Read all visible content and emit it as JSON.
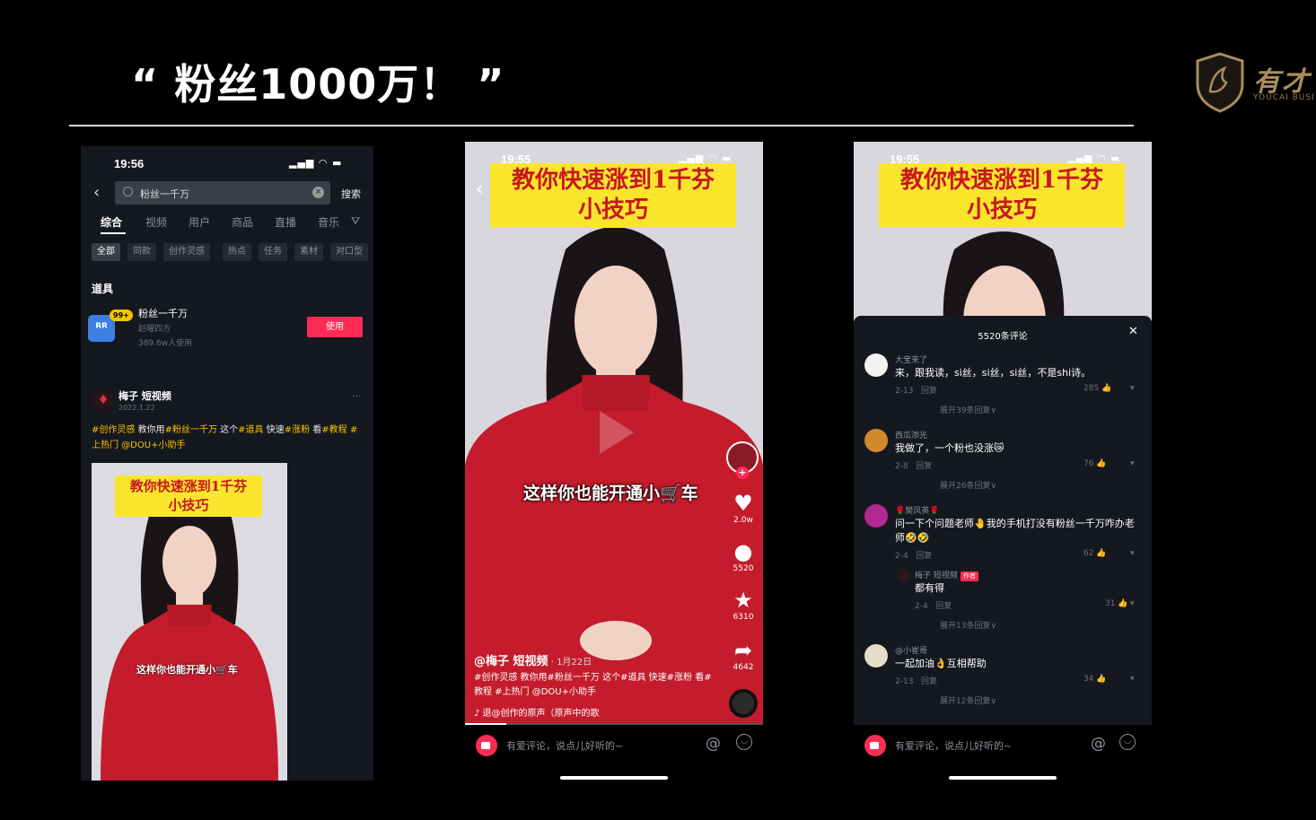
{
  "slide": {
    "title": "“ 粉丝1000万！ ”",
    "logo_text": "有才",
    "logo_sub": "YOUCAI BUSI"
  },
  "phone_search": {
    "status_time": "19:56",
    "search_query": "粉丝一千万",
    "search_button": "搜索",
    "tabs": [
      "综合",
      "视频",
      "用户",
      "商品",
      "直播",
      "音乐"
    ],
    "chips": [
      "全部",
      "同款",
      "创作灵感",
      "热点",
      "任务",
      "素材",
      "对口型"
    ],
    "section_label": "道具",
    "prop": {
      "badge": "99+",
      "name": "粉丝一千万",
      "author": "赵曜四方",
      "users": "389.6w人使用",
      "use_button": "使用"
    },
    "post": {
      "author": "梅子 短视频",
      "date": "2022.1.22",
      "caption_part1": "#创作灵感 ",
      "caption_part2": "教你用",
      "caption_part3": "#粉丝一千万",
      "caption_part4": " 这个",
      "caption_part5": "#道具",
      "caption_part6": " 快速",
      "caption_part7": "#涨粉",
      "caption_part8": " 看",
      "caption_part9": "#教程 #上热门",
      "caption_part10": " @DOU+小助手"
    },
    "thumb": {
      "banner_line1": "教你快速涨到1千芬",
      "banner_line2": "小技巧",
      "subtitle": "这样你也能开通小🛒车"
    }
  },
  "phone_video": {
    "status_time": "19:55",
    "banner_line1": "教你快速涨到1千芬",
    "banner_line2": "小技巧",
    "subtitle": "这样你也能开通小🛒车",
    "likes": "2.0w",
    "comments": "5520",
    "favorites": "6310",
    "shares": "4642",
    "author": "@梅子 短视频",
    "date": " · 1月22日",
    "caption": "#创作灵感 教你用#粉丝一千万 这个#道具 快速#涨粉 看#教程 #上热门 @DOU+小助手",
    "music": "♪ 退@创作的原声（原声中的歌",
    "comment_placeholder": "有爱评论，说点儿好听的~",
    "progress": 0.14
  },
  "phone_comments": {
    "status_time": "19:55",
    "banner_line1": "教你快速涨到1千芬",
    "banner_line2": "小技巧",
    "comment_count": "5520条评论",
    "comments": [
      {
        "name": "大宝来了",
        "text": "来，跟我读，si丝，si丝，si丝，不是shi诗。",
        "date": "2-13",
        "reply": "回复",
        "likes": "285",
        "more": "展开39条回复∨"
      },
      {
        "name": "西瓜添光",
        "text": "我做了，一个粉也没涨😿",
        "date": "2-8",
        "reply": "回复",
        "likes": "76",
        "more": "展开26条回复∨"
      },
      {
        "name": "🌹樊凤英🌹",
        "text": "问一下个问题老师🤚我的手机打没有粉丝一千万咋办老师🤣🤣",
        "date": "2-4",
        "reply": "回复",
        "likes": "62",
        "more": ""
      },
      {
        "name": "梅子 短视频",
        "tag": "作者",
        "text": "都有得",
        "date": "2-4",
        "reply": "回复",
        "likes": "31",
        "more": "展开13条回复∨"
      },
      {
        "name": "@小崔哥",
        "text": "一起加油👌互相帮助",
        "date": "2-13",
        "reply": "回复",
        "likes": "34",
        "more": "展开12条回复∨"
      }
    ],
    "comment_placeholder": "有爱评论，说点儿好听的~"
  },
  "colors": {
    "background": "#000000",
    "accent_red": "#fe2c55",
    "banner_yellow": "#f9e62c",
    "banner_text": "#c8171f",
    "sweater_red": "#c41c2c"
  }
}
